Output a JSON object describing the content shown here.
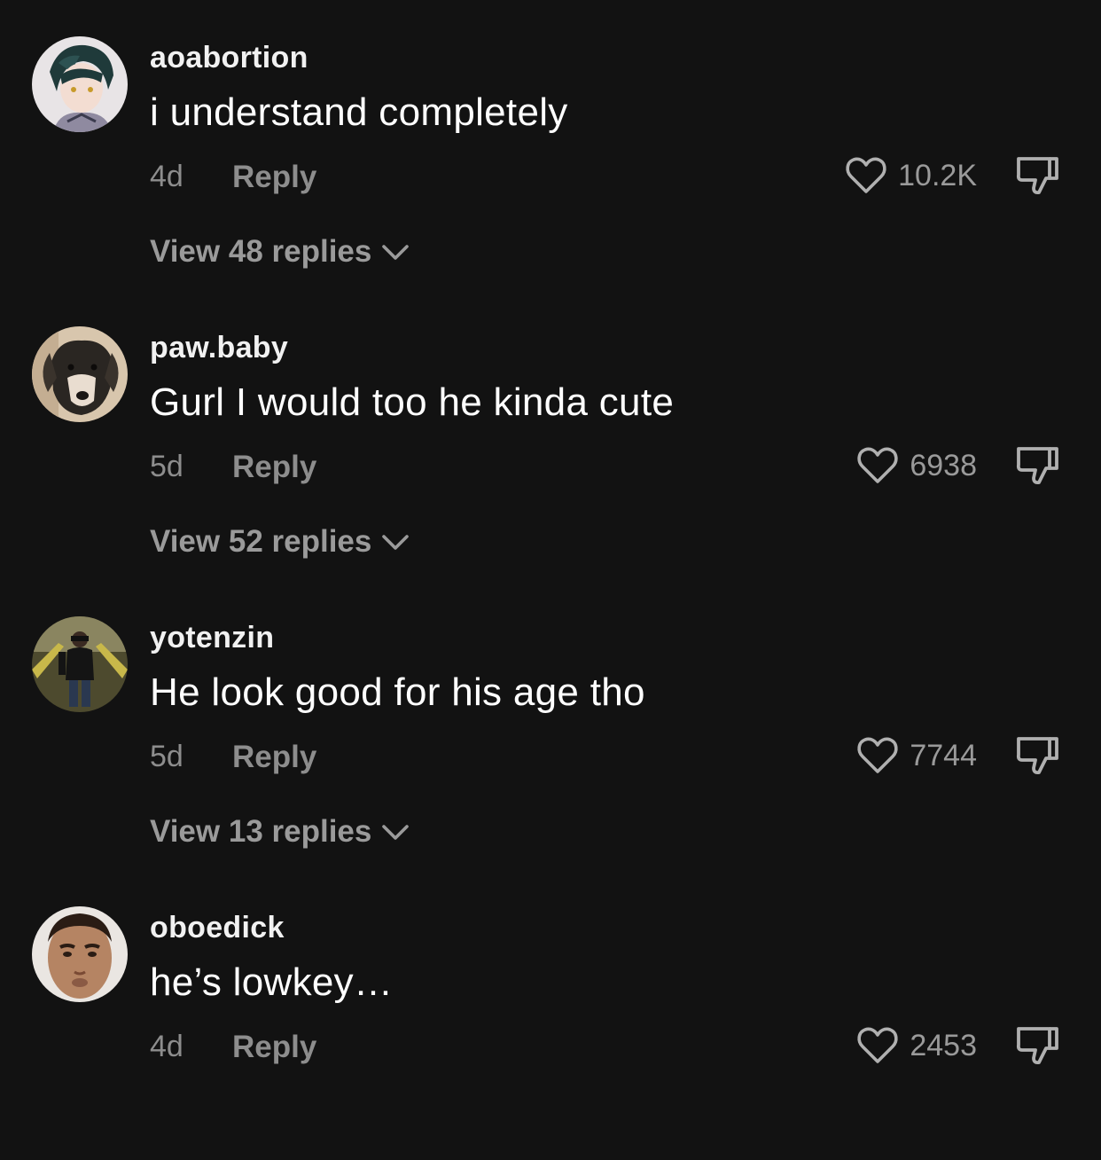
{
  "comments": [
    {
      "username": "aoabortion",
      "text": "i understand completely",
      "age": "4d",
      "reply_label": "Reply",
      "likes": "10.2K",
      "view_replies": "View 48 replies",
      "avatar_icon": "anime-character-avatar"
    },
    {
      "username": "paw.baby",
      "text": "Gurl I would too he kinda cute",
      "age": "5d",
      "reply_label": "Reply",
      "likes": "6938",
      "view_replies": "View 52 replies",
      "avatar_icon": "dog-photo-avatar"
    },
    {
      "username": "yotenzin",
      "text": "He look good for his age tho",
      "age": "5d",
      "reply_label": "Reply",
      "likes": "7744",
      "view_replies": "View 13 replies",
      "avatar_icon": "person-escalator-avatar"
    },
    {
      "username": "oboedick",
      "text": "he’s lowkey…",
      "age": "4d",
      "reply_label": "Reply",
      "likes": "2453",
      "avatar_icon": "face-photo-avatar"
    }
  ],
  "colors": {
    "background": "#121212",
    "primary_text": "#ffffff",
    "secondary_text": "#8d8d8d",
    "icon_stroke": "#b0b0b0"
  }
}
